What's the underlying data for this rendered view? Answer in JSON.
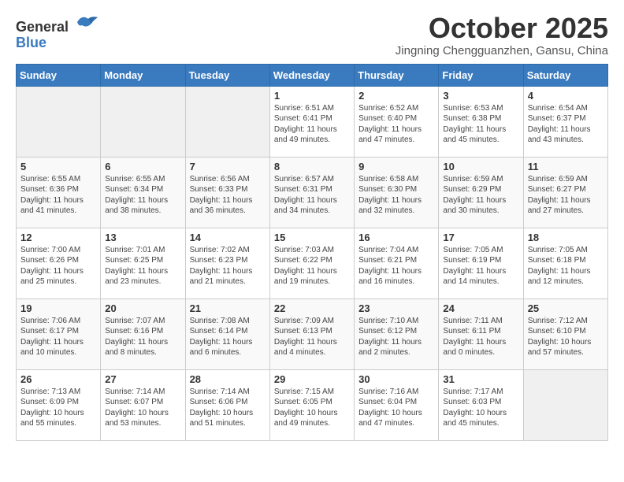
{
  "header": {
    "logo_general": "General",
    "logo_blue": "Blue",
    "month_title": "October 2025",
    "location": "Jingning Chengguanzhen, Gansu, China"
  },
  "weekdays": [
    "Sunday",
    "Monday",
    "Tuesday",
    "Wednesday",
    "Thursday",
    "Friday",
    "Saturday"
  ],
  "weeks": [
    [
      {
        "day": "",
        "sunrise": "",
        "sunset": "",
        "daylight": ""
      },
      {
        "day": "",
        "sunrise": "",
        "sunset": "",
        "daylight": ""
      },
      {
        "day": "",
        "sunrise": "",
        "sunset": "",
        "daylight": ""
      },
      {
        "day": "1",
        "sunrise": "Sunrise: 6:51 AM",
        "sunset": "Sunset: 6:41 PM",
        "daylight": "Daylight: 11 hours and 49 minutes."
      },
      {
        "day": "2",
        "sunrise": "Sunrise: 6:52 AM",
        "sunset": "Sunset: 6:40 PM",
        "daylight": "Daylight: 11 hours and 47 minutes."
      },
      {
        "day": "3",
        "sunrise": "Sunrise: 6:53 AM",
        "sunset": "Sunset: 6:38 PM",
        "daylight": "Daylight: 11 hours and 45 minutes."
      },
      {
        "day": "4",
        "sunrise": "Sunrise: 6:54 AM",
        "sunset": "Sunset: 6:37 PM",
        "daylight": "Daylight: 11 hours and 43 minutes."
      }
    ],
    [
      {
        "day": "5",
        "sunrise": "Sunrise: 6:55 AM",
        "sunset": "Sunset: 6:36 PM",
        "daylight": "Daylight: 11 hours and 41 minutes."
      },
      {
        "day": "6",
        "sunrise": "Sunrise: 6:55 AM",
        "sunset": "Sunset: 6:34 PM",
        "daylight": "Daylight: 11 hours and 38 minutes."
      },
      {
        "day": "7",
        "sunrise": "Sunrise: 6:56 AM",
        "sunset": "Sunset: 6:33 PM",
        "daylight": "Daylight: 11 hours and 36 minutes."
      },
      {
        "day": "8",
        "sunrise": "Sunrise: 6:57 AM",
        "sunset": "Sunset: 6:31 PM",
        "daylight": "Daylight: 11 hours and 34 minutes."
      },
      {
        "day": "9",
        "sunrise": "Sunrise: 6:58 AM",
        "sunset": "Sunset: 6:30 PM",
        "daylight": "Daylight: 11 hours and 32 minutes."
      },
      {
        "day": "10",
        "sunrise": "Sunrise: 6:59 AM",
        "sunset": "Sunset: 6:29 PM",
        "daylight": "Daylight: 11 hours and 30 minutes."
      },
      {
        "day": "11",
        "sunrise": "Sunrise: 6:59 AM",
        "sunset": "Sunset: 6:27 PM",
        "daylight": "Daylight: 11 hours and 27 minutes."
      }
    ],
    [
      {
        "day": "12",
        "sunrise": "Sunrise: 7:00 AM",
        "sunset": "Sunset: 6:26 PM",
        "daylight": "Daylight: 11 hours and 25 minutes."
      },
      {
        "day": "13",
        "sunrise": "Sunrise: 7:01 AM",
        "sunset": "Sunset: 6:25 PM",
        "daylight": "Daylight: 11 hours and 23 minutes."
      },
      {
        "day": "14",
        "sunrise": "Sunrise: 7:02 AM",
        "sunset": "Sunset: 6:23 PM",
        "daylight": "Daylight: 11 hours and 21 minutes."
      },
      {
        "day": "15",
        "sunrise": "Sunrise: 7:03 AM",
        "sunset": "Sunset: 6:22 PM",
        "daylight": "Daylight: 11 hours and 19 minutes."
      },
      {
        "day": "16",
        "sunrise": "Sunrise: 7:04 AM",
        "sunset": "Sunset: 6:21 PM",
        "daylight": "Daylight: 11 hours and 16 minutes."
      },
      {
        "day": "17",
        "sunrise": "Sunrise: 7:05 AM",
        "sunset": "Sunset: 6:19 PM",
        "daylight": "Daylight: 11 hours and 14 minutes."
      },
      {
        "day": "18",
        "sunrise": "Sunrise: 7:05 AM",
        "sunset": "Sunset: 6:18 PM",
        "daylight": "Daylight: 11 hours and 12 minutes."
      }
    ],
    [
      {
        "day": "19",
        "sunrise": "Sunrise: 7:06 AM",
        "sunset": "Sunset: 6:17 PM",
        "daylight": "Daylight: 11 hours and 10 minutes."
      },
      {
        "day": "20",
        "sunrise": "Sunrise: 7:07 AM",
        "sunset": "Sunset: 6:16 PM",
        "daylight": "Daylight: 11 hours and 8 minutes."
      },
      {
        "day": "21",
        "sunrise": "Sunrise: 7:08 AM",
        "sunset": "Sunset: 6:14 PM",
        "daylight": "Daylight: 11 hours and 6 minutes."
      },
      {
        "day": "22",
        "sunrise": "Sunrise: 7:09 AM",
        "sunset": "Sunset: 6:13 PM",
        "daylight": "Daylight: 11 hours and 4 minutes."
      },
      {
        "day": "23",
        "sunrise": "Sunrise: 7:10 AM",
        "sunset": "Sunset: 6:12 PM",
        "daylight": "Daylight: 11 hours and 2 minutes."
      },
      {
        "day": "24",
        "sunrise": "Sunrise: 7:11 AM",
        "sunset": "Sunset: 6:11 PM",
        "daylight": "Daylight: 11 hours and 0 minutes."
      },
      {
        "day": "25",
        "sunrise": "Sunrise: 7:12 AM",
        "sunset": "Sunset: 6:10 PM",
        "daylight": "Daylight: 10 hours and 57 minutes."
      }
    ],
    [
      {
        "day": "26",
        "sunrise": "Sunrise: 7:13 AM",
        "sunset": "Sunset: 6:09 PM",
        "daylight": "Daylight: 10 hours and 55 minutes."
      },
      {
        "day": "27",
        "sunrise": "Sunrise: 7:14 AM",
        "sunset": "Sunset: 6:07 PM",
        "daylight": "Daylight: 10 hours and 53 minutes."
      },
      {
        "day": "28",
        "sunrise": "Sunrise: 7:14 AM",
        "sunset": "Sunset: 6:06 PM",
        "daylight": "Daylight: 10 hours and 51 minutes."
      },
      {
        "day": "29",
        "sunrise": "Sunrise: 7:15 AM",
        "sunset": "Sunset: 6:05 PM",
        "daylight": "Daylight: 10 hours and 49 minutes."
      },
      {
        "day": "30",
        "sunrise": "Sunrise: 7:16 AM",
        "sunset": "Sunset: 6:04 PM",
        "daylight": "Daylight: 10 hours and 47 minutes."
      },
      {
        "day": "31",
        "sunrise": "Sunrise: 7:17 AM",
        "sunset": "Sunset: 6:03 PM",
        "daylight": "Daylight: 10 hours and 45 minutes."
      },
      {
        "day": "",
        "sunrise": "",
        "sunset": "",
        "daylight": ""
      }
    ]
  ]
}
